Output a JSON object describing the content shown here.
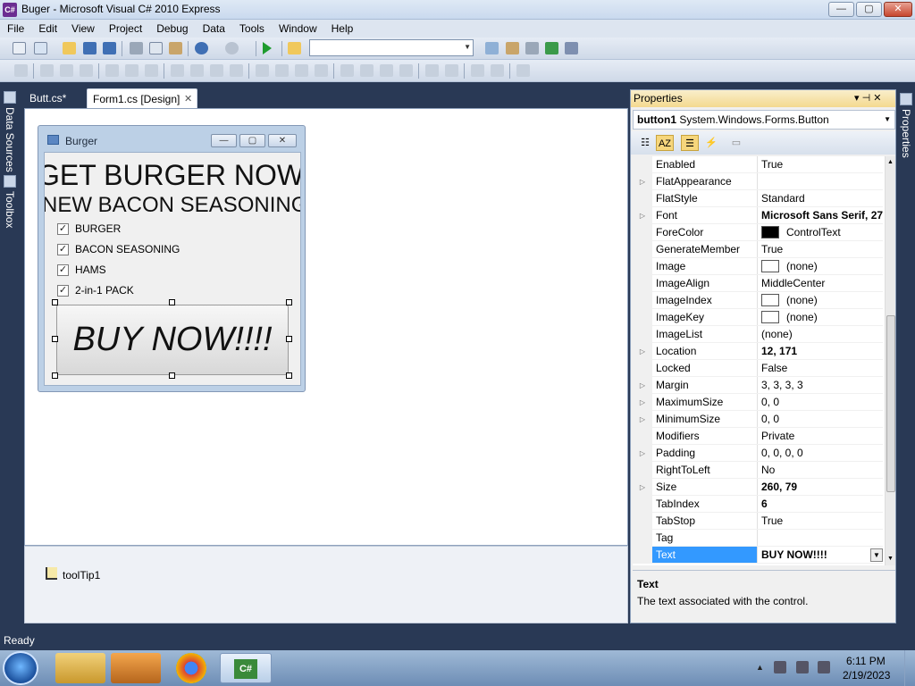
{
  "window": {
    "title": "Buger - Microsoft Visual C# 2010 Express",
    "app_icon": "C#",
    "minimize": "—",
    "maximize": "▢",
    "close": "✕"
  },
  "menu": [
    "File",
    "Edit",
    "View",
    "Project",
    "Debug",
    "Data",
    "Tools",
    "Window",
    "Help"
  ],
  "left_tabs": {
    "data_sources": "Data Sources",
    "toolbox": "Toolbox"
  },
  "right_tabs": {
    "properties": "Properties"
  },
  "doc_tabs": [
    {
      "label": "Butt.cs*"
    },
    {
      "label": "Form1.cs [Design]",
      "close": "✕"
    }
  ],
  "form": {
    "title": "Burger",
    "label1": "GET BURGER NOW",
    "label2": "NEW BACON SEASONING",
    "checkboxes": [
      {
        "label": "BURGER",
        "checked": true
      },
      {
        "label": "BACON SEASONING",
        "checked": true
      },
      {
        "label": "HAMS",
        "checked": true
      },
      {
        "label": "2-in-1 PACK",
        "checked": true
      }
    ],
    "check_mark": "✓",
    "button_text": "BUY NOW!!!!"
  },
  "tray": {
    "component": "toolTip1"
  },
  "properties": {
    "header": "Properties",
    "pin": "▾ ⊣ ✕",
    "object_name": "button1",
    "object_type": "System.Windows.Forms.Button",
    "rows": [
      {
        "name": "Enabled",
        "value": "True",
        "expand": false,
        "bold": false
      },
      {
        "name": "FlatAppearance",
        "value": "",
        "expand": true,
        "bold": false
      },
      {
        "name": "FlatStyle",
        "value": "Standard",
        "expand": false,
        "bold": false
      },
      {
        "name": "Font",
        "value": "Microsoft Sans Serif, 27",
        "expand": true,
        "bold": true
      },
      {
        "name": "ForeColor",
        "value": "ControlText",
        "expand": false,
        "bold": false,
        "swatch": "#000000"
      },
      {
        "name": "GenerateMember",
        "value": "True",
        "expand": false,
        "bold": false
      },
      {
        "name": "Image",
        "value": "(none)",
        "expand": false,
        "bold": false,
        "swatch": "#ffffff"
      },
      {
        "name": "ImageAlign",
        "value": "MiddleCenter",
        "expand": false,
        "bold": false
      },
      {
        "name": "ImageIndex",
        "value": "(none)",
        "expand": false,
        "bold": false,
        "swatch": "#ffffff"
      },
      {
        "name": "ImageKey",
        "value": "(none)",
        "expand": false,
        "bold": false,
        "swatch": "#ffffff"
      },
      {
        "name": "ImageList",
        "value": "(none)",
        "expand": false,
        "bold": false
      },
      {
        "name": "Location",
        "value": "12, 171",
        "expand": true,
        "bold": true
      },
      {
        "name": "Locked",
        "value": "False",
        "expand": false,
        "bold": false
      },
      {
        "name": "Margin",
        "value": "3, 3, 3, 3",
        "expand": true,
        "bold": false
      },
      {
        "name": "MaximumSize",
        "value": "0, 0",
        "expand": true,
        "bold": false
      },
      {
        "name": "MinimumSize",
        "value": "0, 0",
        "expand": true,
        "bold": false
      },
      {
        "name": "Modifiers",
        "value": "Private",
        "expand": false,
        "bold": false
      },
      {
        "name": "Padding",
        "value": "0, 0, 0, 0",
        "expand": true,
        "bold": false
      },
      {
        "name": "RightToLeft",
        "value": "No",
        "expand": false,
        "bold": false
      },
      {
        "name": "Size",
        "value": "260, 79",
        "expand": true,
        "bold": true
      },
      {
        "name": "TabIndex",
        "value": "6",
        "expand": false,
        "bold": true
      },
      {
        "name": "TabStop",
        "value": "True",
        "expand": false,
        "bold": false
      },
      {
        "name": "Tag",
        "value": "",
        "expand": false,
        "bold": false
      },
      {
        "name": "Text",
        "value": "BUY NOW!!!!",
        "expand": false,
        "bold": true,
        "selected": true
      }
    ],
    "description_title": "Text",
    "description_text": "The text associated with the control."
  },
  "status": "Ready",
  "clock": {
    "time": "6:11 PM",
    "date": "2/19/2023"
  },
  "colors": {
    "accent": "#293955",
    "selection": "#3399ff",
    "panel_header": "#f4d98f"
  }
}
